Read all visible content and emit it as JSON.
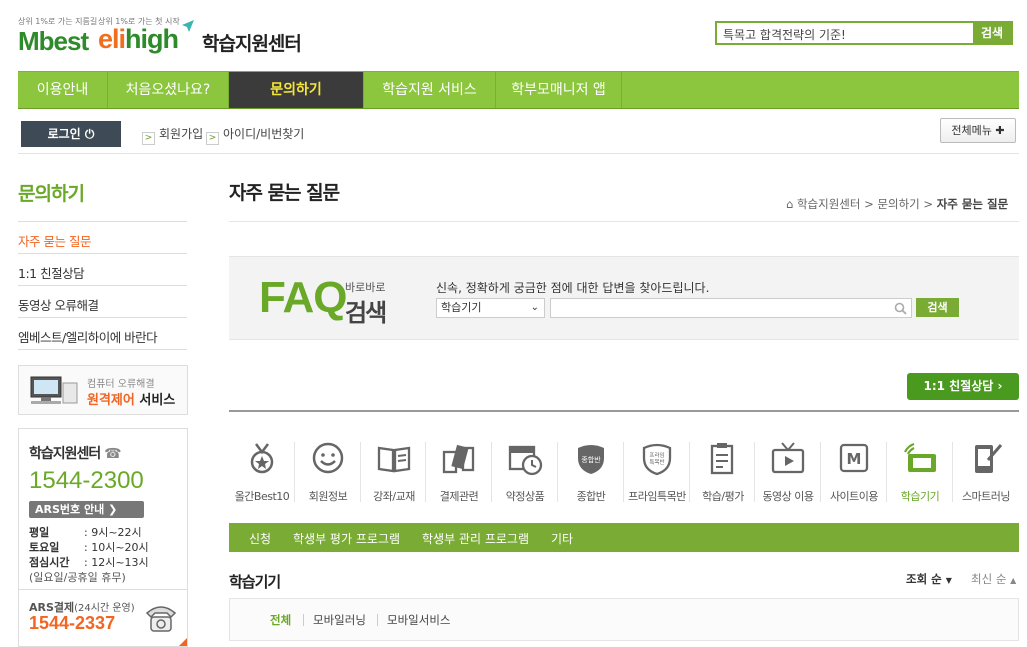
{
  "brand": {
    "tag1": "상위 1%로 가는 지름길",
    "tag2": "상위 1%로 가는 첫 시작",
    "mbest": "Mbest",
    "elihigh_a": "eli",
    "elihigh_b": "high",
    "center": "학습지원센터"
  },
  "top_search": {
    "value": "특목고 합격전략의 기준!",
    "button": "검색"
  },
  "gnb": [
    {
      "label": "이용안내"
    },
    {
      "label": "처음오셨나요?"
    },
    {
      "label": "문의하기"
    },
    {
      "label": "학습지원 서비스"
    },
    {
      "label": "학부모매니저 앱"
    }
  ],
  "util": {
    "login": "로그인",
    "join": "회원가입",
    "find": "아이디/비번찾기",
    "allmenu": "전체메뉴"
  },
  "lnb": {
    "title": "문의하기",
    "items": [
      "자주 묻는 질문",
      "1:1 친절상담",
      "동영상 오류해결",
      "엠베스트/엘리하이에 바란다"
    ],
    "banner_small": "컴퓨터 오류해결",
    "banner_orange": "원격제어",
    "banner_rest": " 서비스"
  },
  "contact": {
    "title": "학습지원센터",
    "phone": "1544-2300",
    "ars": "ARS번호 안내",
    "rows": [
      {
        "k": "평일",
        "v": ": 9시~22시"
      },
      {
        "k": "토요일",
        "v": ": 10시~20시"
      },
      {
        "k": "점심시간",
        "v": ": 12시~13시"
      }
    ],
    "note": "(일요일/공휴일 휴무)",
    "ars_pay": "ARS결제",
    "ars_pay_note": "(24시간 운영)",
    "phone2": "1544-2337"
  },
  "page": {
    "title": "자주 묻는 질문",
    "crumb": [
      "학습지원센터",
      "문의하기",
      "자주 묻는 질문"
    ]
  },
  "faq": {
    "big": "FAQ",
    "small": "바로바로",
    "search_word": "검색",
    "desc": "신속, 정확하게 궁금한 점에 대한 답변을 찾아드립니다.",
    "select": "학습기기",
    "button": "검색"
  },
  "consult_button": "1:1 친절상담",
  "categories": [
    {
      "label": "올간Best10",
      "icon": "medal-icon"
    },
    {
      "label": "회원정보",
      "icon": "smile-icon"
    },
    {
      "label": "강좌/교재",
      "icon": "book-icon"
    },
    {
      "label": "결제관련",
      "icon": "cards-icon"
    },
    {
      "label": "약정상품",
      "icon": "calendar-clock-icon"
    },
    {
      "label": "종합반",
      "icon": "badge-icon"
    },
    {
      "label": "프라임특목반",
      "icon": "prime-badge-icon"
    },
    {
      "label": "학습/평가",
      "icon": "clipboard-icon"
    },
    {
      "label": "동영상 이용",
      "icon": "tv-icon"
    },
    {
      "label": "사이트이용",
      "icon": "m-icon"
    },
    {
      "label": "학습기기",
      "icon": "device-icon"
    },
    {
      "label": "스마트러닝",
      "icon": "phone-pen-icon"
    }
  ],
  "subtabs": [
    "신청",
    "학생부 평가 프로그램",
    "학생부 관리 프로그램",
    "기타"
  ],
  "list": {
    "title": "학습기기",
    "sort1": "조회 순",
    "sort2": "최신 순",
    "filters": [
      "전체",
      "모바일러닝",
      "모바일서비스"
    ]
  },
  "colors": {
    "green": "#8cc63e",
    "dark_green": "#6aa828",
    "orange": "#f26522",
    "active_nav": "#3b3b3b"
  }
}
